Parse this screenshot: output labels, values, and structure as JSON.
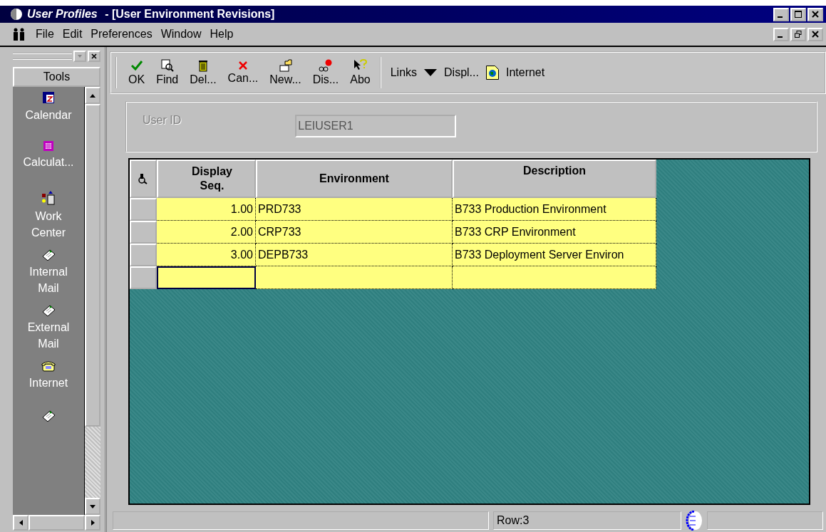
{
  "window": {
    "title_app": "User Profiles",
    "title_form": " - [User Environment Revisions]"
  },
  "menu": [
    "File",
    "Edit",
    "Preferences",
    "Window",
    "Help"
  ],
  "sidebar": {
    "title": "Tools",
    "items": [
      {
        "kind": "calendar",
        "label": "Calendar"
      },
      {
        "kind": "calculator",
        "label": "Calculat..."
      },
      {
        "kind": "workcenter",
        "label": "Work Center"
      },
      {
        "kind": "mail",
        "label": "Internal Mail"
      },
      {
        "kind": "mail",
        "label": "External Mail"
      },
      {
        "kind": "phone",
        "label": "Internet"
      },
      {
        "kind": "mail"
      }
    ]
  },
  "toolbar": {
    "buttons": [
      {
        "kind": "ok",
        "label": "OK"
      },
      {
        "kind": "find",
        "label": "Find"
      },
      {
        "kind": "delete",
        "label": "Del..."
      },
      {
        "kind": "cancel",
        "label": "Can..."
      },
      {
        "kind": "new",
        "label": "New..."
      },
      {
        "kind": "display",
        "label": "Dis..."
      },
      {
        "kind": "about",
        "label": "Abo"
      }
    ],
    "links": "Links",
    "display": "Displ...",
    "internet": "Internet"
  },
  "form": {
    "user_id_label": "User ID",
    "user_id_value": "LEIUSER1"
  },
  "grid": {
    "columns": [
      "Display Seq.",
      "Environment",
      "Description"
    ],
    "rows": [
      {
        "seq": "1.00",
        "environment": "PRD733",
        "description": "B733 Production Environment"
      },
      {
        "seq": "2.00",
        "environment": "CRP733",
        "description": "B733 CRP Environment"
      },
      {
        "seq": "3.00",
        "environment": "DEPB733",
        "description": "B733 Deployment Server Environ"
      }
    ],
    "new_row": {
      "focused": true
    }
  },
  "status_bar": {
    "row": "Row:3"
  }
}
